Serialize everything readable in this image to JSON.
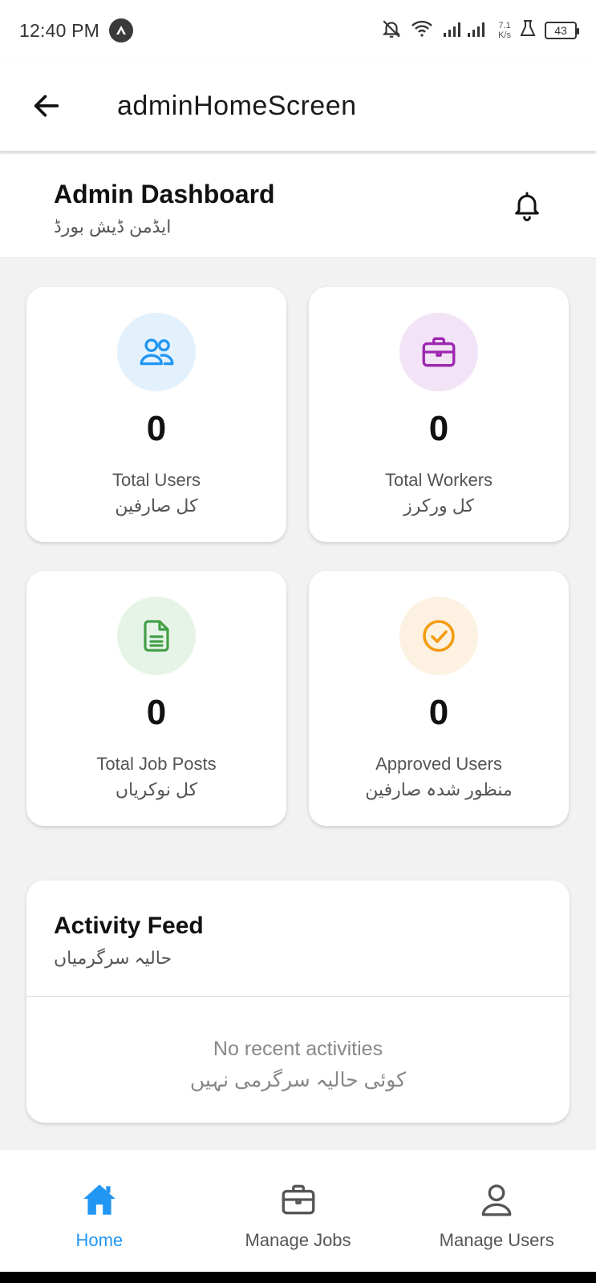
{
  "status_bar": {
    "time": "12:40 PM",
    "net_speed_value": "7.1",
    "net_speed_unit": "K/s",
    "battery": "43"
  },
  "app_bar": {
    "title": "adminHomeScreen"
  },
  "dashboard": {
    "title": "Admin Dashboard",
    "subtitle": "ایڈمن ڈیش بورڈ"
  },
  "stats": [
    {
      "value": "0",
      "label": "Total Users",
      "sublabel": "کل صارفین",
      "icon": "users-icon",
      "color": "#2196F3",
      "bg": "#e3f1fd"
    },
    {
      "value": "0",
      "label": "Total Workers",
      "sublabel": "کل ورکرز",
      "icon": "briefcase-icon",
      "color": "#9c27b0",
      "bg": "#f3e3f6"
    },
    {
      "value": "0",
      "label": "Total Job Posts",
      "sublabel": "کل نوکریاں",
      "icon": "document-icon",
      "color": "#43a047",
      "bg": "#e6f3e7"
    },
    {
      "value": "0",
      "label": "Approved Users",
      "sublabel": "منظور شدہ صارفین",
      "icon": "check-circle-icon",
      "color": "#f39c12",
      "bg": "#fdf1e1"
    }
  ],
  "activity": {
    "title": "Activity Feed",
    "subtitle": "حالیہ سرگرمیاں",
    "empty_text": "No recent activities",
    "empty_subtext": "کوئی حالیہ سرگرمی نہیں"
  },
  "bottom_nav": {
    "items": [
      {
        "label": "Home",
        "icon": "home-icon",
        "active": true
      },
      {
        "label": "Manage Jobs",
        "icon": "briefcase-icon",
        "active": false
      },
      {
        "label": "Manage Users",
        "icon": "person-icon",
        "active": false
      }
    ],
    "active_color": "#2196F3"
  }
}
